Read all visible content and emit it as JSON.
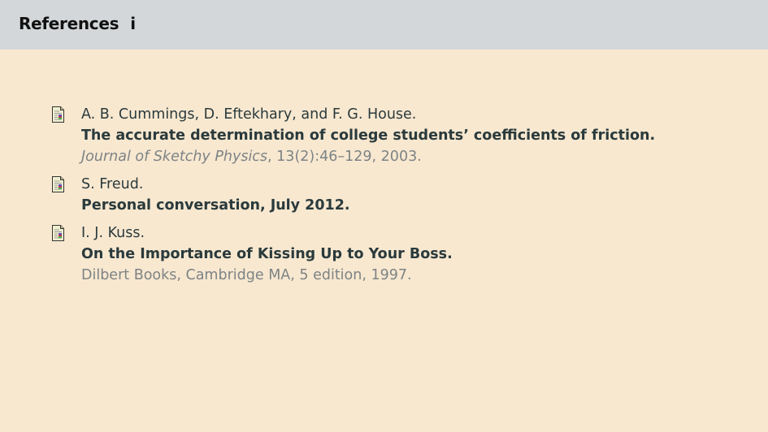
{
  "header": {
    "title": "References",
    "page_marker": "i"
  },
  "references": [
    {
      "icon": "article-icon",
      "authors": "A. B. Cummings, D. Eftekhary, and F. G. House.",
      "title": "The accurate determination of college students’ coefficients of friction.",
      "journal": "Journal of Sketchy Physics",
      "details": ", 13(2):46–129, 2003."
    },
    {
      "icon": "article-icon",
      "authors": "S. Freud.",
      "title": "Personal conversation, July 2012."
    },
    {
      "icon": "article-icon",
      "authors": "I. J. Kuss.",
      "title": "On the Importance of Kissing Up to Your Boss.",
      "details": "Dilbert Books, Cambridge MA, 5 edition, 1997."
    }
  ]
}
